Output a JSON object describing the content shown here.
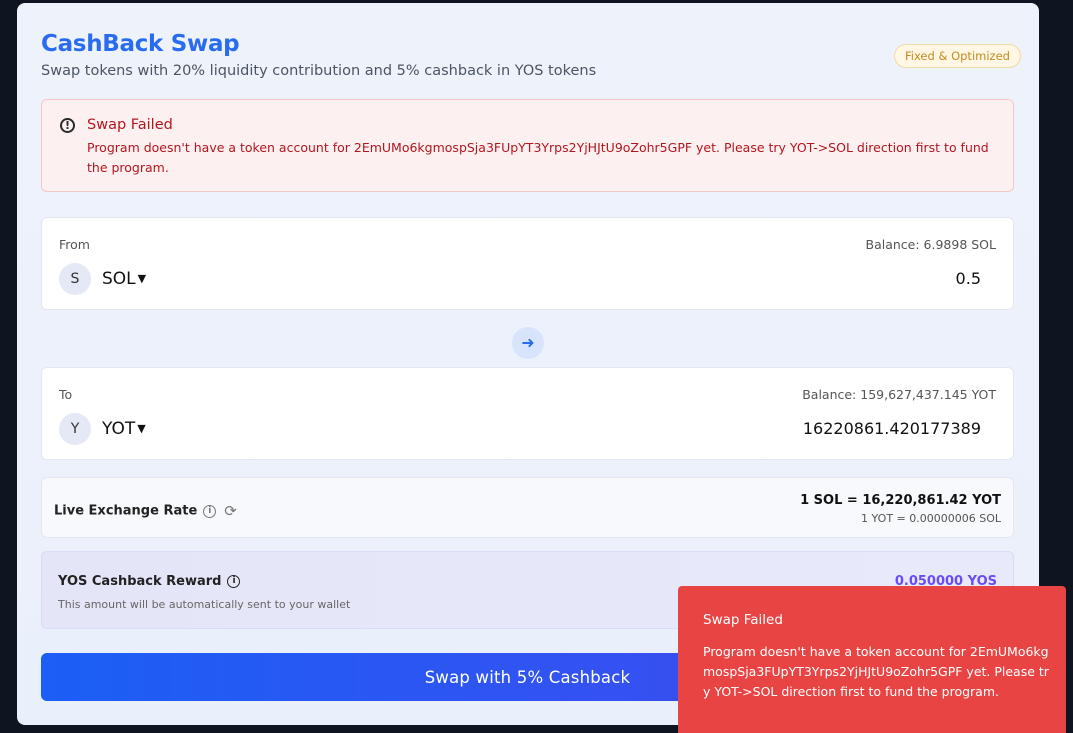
{
  "header": {
    "title": "CashBack Swap",
    "subtitle": "Swap tokens with 20% liquidity contribution and 5% cashback in YOS tokens",
    "badge": "Fixed & Optimized"
  },
  "alert": {
    "title": "Swap Failed",
    "message": "Program doesn't have a token account for 2EmUMo6kgmospSja3FUpYT3Yrps2YjHJtU9oZohr5GPF yet. Please try YOT->SOL direction first to fund the program."
  },
  "from": {
    "label": "From",
    "balance": "Balance: 6.9898 SOL",
    "token_initial": "S",
    "token": "SOL",
    "amount": "0.5"
  },
  "direction_icon": "arrow-right-icon",
  "to": {
    "label": "To",
    "balance": "Balance: 159,627,437.145 YOT",
    "token_initial": "Y",
    "token": "YOT",
    "amount": "16220861.420177389"
  },
  "rate": {
    "label": "Live Exchange Rate",
    "main": "1 SOL = 16,220,861.42 YOT",
    "inverse": "1 YOT = 0.00000006 SOL"
  },
  "cashback": {
    "title": "YOS Cashback Reward",
    "note": "This amount will be automatically sent to your wallet",
    "value": "0.050000 YOS"
  },
  "swap_button": "Swap with 5% Cashback",
  "toast": {
    "title": "Swap Failed",
    "message": "Program doesn't have a token account for 2EmUMo6kgmospSja3FUpYT3Yrps2YjHJtU9oZohr5GPF yet. Please try YOT->SOL direction first to fund the program."
  },
  "colors": {
    "accent": "#2a6cf0",
    "error": "#b3161f",
    "toast": "#e84444",
    "cashback": "#6a4cf0"
  }
}
